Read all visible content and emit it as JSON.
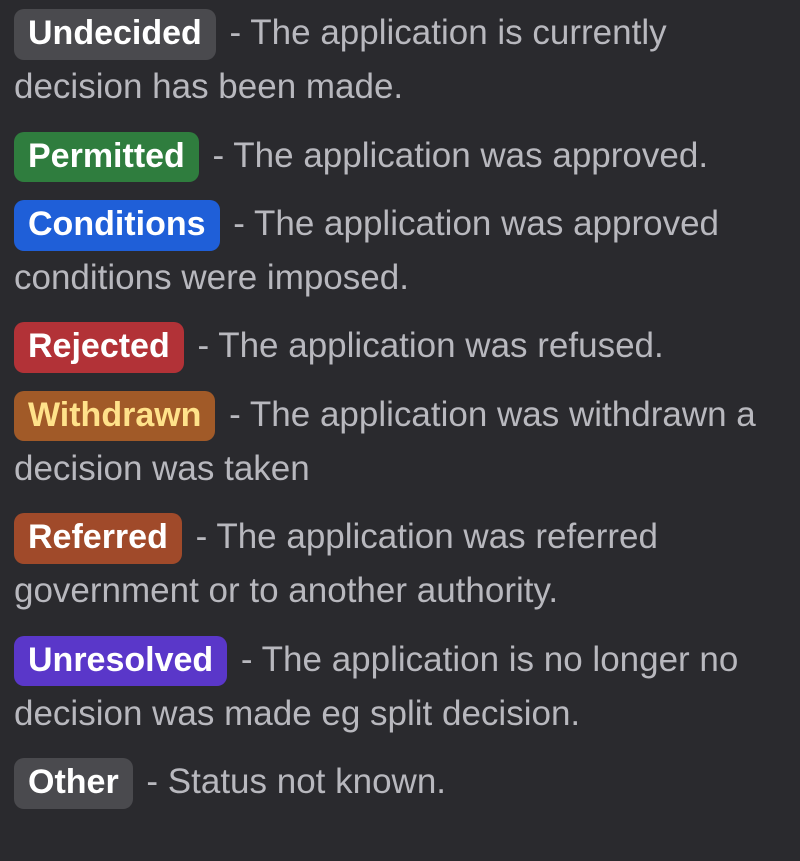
{
  "statuses": [
    {
      "label": "Undecided",
      "bg": "#4a4a4e",
      "fg": "#ffffff",
      "desc": " - The application is currently decision has been made."
    },
    {
      "label": "Permitted",
      "bg": "#2f7d3e",
      "fg": "#ffffff",
      "desc": " - The application was approved."
    },
    {
      "label": "Conditions",
      "bg": "#1f5fd8",
      "fg": "#ffffff",
      "desc": " - The application was approved conditions were imposed."
    },
    {
      "label": "Rejected",
      "bg": "#b23237",
      "fg": "#ffffff",
      "desc": " - The application was refused."
    },
    {
      "label": "Withdrawn",
      "bg": "#a15a28",
      "fg": "#ffe28a",
      "desc": " - The application was withdrawn a decision was taken"
    },
    {
      "label": "Referred",
      "bg": "#a04a2a",
      "fg": "#ffffff",
      "desc": " - The application was referred government or to another authority."
    },
    {
      "label": "Unresolved",
      "bg": "#5a37c9",
      "fg": "#ffffff",
      "desc": " - The application is no longer no decision was made eg split decision."
    },
    {
      "label": "Other",
      "bg": "#4a4a4e",
      "fg": "#ffffff",
      "desc": " - Status not known."
    }
  ]
}
